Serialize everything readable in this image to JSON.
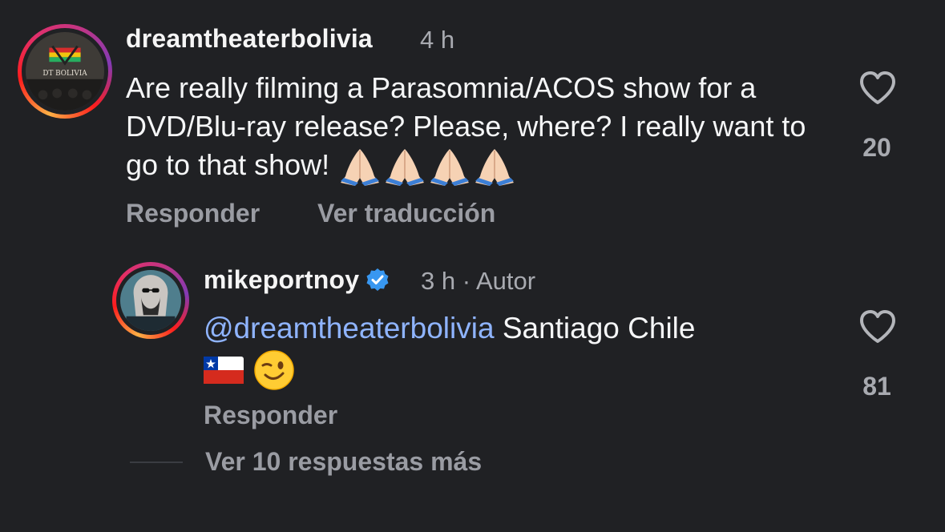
{
  "comment": {
    "username": "dreamtheaterbolivia",
    "time": "4 h",
    "text": "Are really filming a Parasomnia/ACOS show for a DVD/Blu-ray release? Please, where? I really want to go to that show!",
    "emoji_count": 4,
    "avatar_text": "DT BOLIVIA",
    "likes": "20",
    "reply_label": "Responder",
    "translate_label": "Ver traducción"
  },
  "reply": {
    "username": "mikeportnoy",
    "time": "3 h",
    "separator": "·",
    "author_label": "Autor",
    "mention": "@dreamtheaterbolivia",
    "text": "Santiago Chile",
    "likes": "81",
    "reply_label": "Responder"
  },
  "more_replies_label": "Ver 10 respuestas más",
  "colors": {
    "background": "#202124",
    "mention": "#8fb4ff",
    "verified": "#3897f0",
    "muted": "#a8aab0"
  }
}
